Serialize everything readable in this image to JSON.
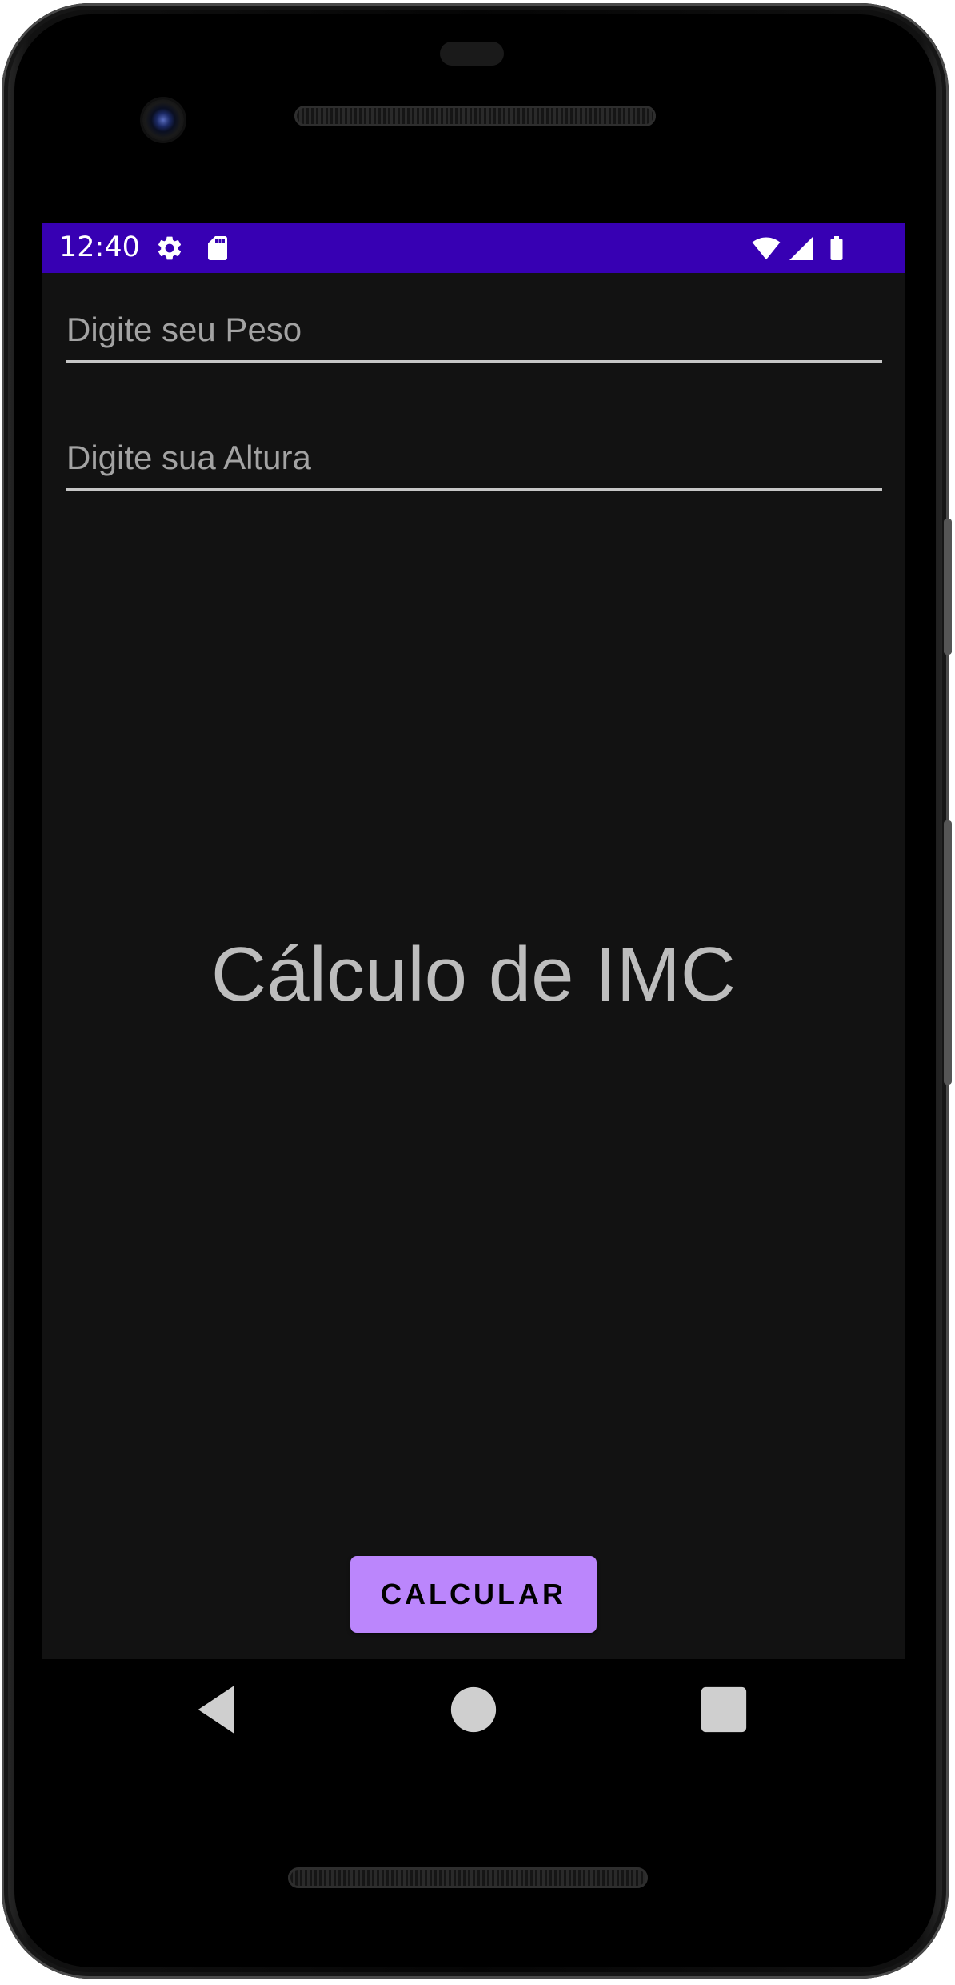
{
  "status_bar": {
    "time": "12:40",
    "icons": [
      "settings-icon",
      "sd-card-icon",
      "wifi-icon",
      "signal-icon",
      "battery-icon"
    ],
    "color": "#3700b3"
  },
  "form": {
    "weight_placeholder": "Digite seu Peso",
    "height_placeholder": "Digite sua Altura",
    "weight_value": "",
    "height_value": ""
  },
  "title": "Cálculo de IMC",
  "calculate_button": {
    "label": "CALCULAR",
    "color": "#bb86fc"
  },
  "navigation": [
    "back-icon",
    "home-icon",
    "recents-icon"
  ],
  "colors": {
    "background": "#121212",
    "text": "#bdbdbd"
  }
}
